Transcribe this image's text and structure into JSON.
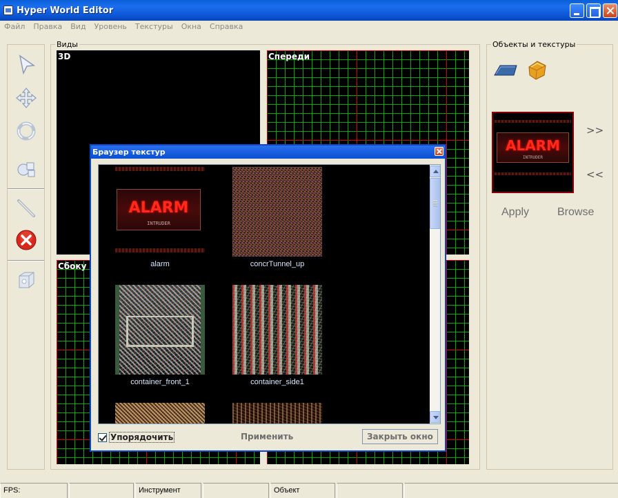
{
  "window": {
    "title": "Hyper World Editor"
  },
  "menu": [
    "Файл",
    "Правка",
    "Вид",
    "Уровень",
    "Текстуры",
    "Окна",
    "Справка"
  ],
  "toolbar": {
    "tools": [
      "select-arrow-icon",
      "move-cross-icon",
      "recycle-icon",
      "rotate-scale-icon",
      "pencil-icon",
      "delete-x-icon",
      "cube-icon"
    ]
  },
  "views": {
    "group_label": "Виды",
    "viewport_3d": "3D",
    "viewport_front": "Спереди",
    "viewport_side": "Сбоку"
  },
  "objects_panel": {
    "group_label": "Объекты и текстуры",
    "icons": [
      "plane-object-icon",
      "cube-object-icon"
    ],
    "next": ">>",
    "prev": "<<",
    "apply": "Apply",
    "browse": "Browse",
    "preview_texture": {
      "word": "ALARM",
      "sub": "INTRUDER"
    }
  },
  "texture_browser": {
    "title": "Браузер текстур",
    "textures": [
      {
        "name": "alarm"
      },
      {
        "name": "concrTunnel_up"
      },
      {
        "name": "container_front_1"
      },
      {
        "name": "container_side1"
      }
    ],
    "alarm_thumb": {
      "word": "ALARM",
      "sub": "INTRUDER"
    },
    "sort_label": "Упорядочить",
    "sort_checked": true,
    "apply_label": "Применить",
    "close_label": "Закрыть окно"
  },
  "statusbar": {
    "fps_label": "FPS:",
    "fps_value": "",
    "tool_label": "Инструмент",
    "tool_value": "",
    "object_label": "Объект",
    "object_value": ""
  },
  "colors": {
    "titlebar": "#0a54d0",
    "grid_major": "#d00000",
    "grid_minor": "#00a800",
    "alarm_red": "#ff2a1a"
  }
}
